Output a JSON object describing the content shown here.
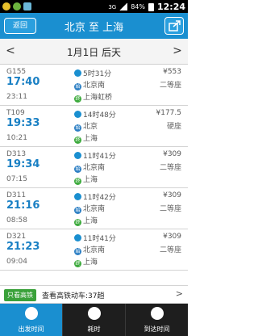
{
  "status_bar": {
    "network": "3G",
    "battery": "84%",
    "time": "12:24"
  },
  "header": {
    "back_label": "返回",
    "title": "北京 至 上海"
  },
  "date_bar": {
    "prev": "<",
    "date": "1月1日 后天",
    "next": ">"
  },
  "trains": [
    {
      "number": "G155",
      "depart": "17:40",
      "arrive": "23:11",
      "duration": "5时31分",
      "from": "北京南",
      "to": "上海虹桥",
      "price": "¥553",
      "seat": "二等座"
    },
    {
      "number": "T109",
      "depart": "19:33",
      "arrive": "10:21",
      "duration": "14时48分",
      "from": "北京",
      "to": "上海",
      "price": "¥177.5",
      "seat": "硬座"
    },
    {
      "number": "D313",
      "depart": "19:34",
      "arrive": "07:15",
      "duration": "11时41分",
      "from": "北京南",
      "to": "上海",
      "price": "¥309",
      "seat": "二等座"
    },
    {
      "number": "D311",
      "depart": "21:16",
      "arrive": "08:58",
      "duration": "11时42分",
      "from": "北京南",
      "to": "上海",
      "price": "¥309",
      "seat": "二等座"
    },
    {
      "number": "D321",
      "depart": "21:23",
      "arrive": "09:04",
      "duration": "11时41分",
      "from": "北京南",
      "to": "上海",
      "price": "¥309",
      "seat": "二等座"
    }
  ],
  "filter_bar": {
    "tag": "只看高铁",
    "text": "查看高铁动车:37趟",
    "chevron": ">"
  },
  "tabs": [
    {
      "label": "出发时间"
    },
    {
      "label": "耗时"
    },
    {
      "label": "到达时间"
    }
  ],
  "colors": {
    "accent": "#1a8fd0",
    "tab_bar": "#1e1e1e",
    "tag_green": "#3aa13a"
  }
}
